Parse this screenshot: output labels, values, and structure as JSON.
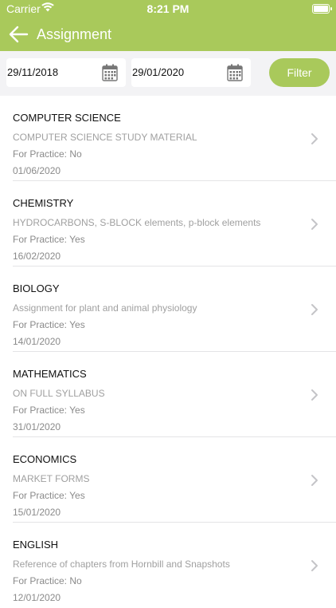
{
  "status": {
    "carrier": "Carrier",
    "time": "8:21 PM"
  },
  "nav": {
    "title": "Assignment"
  },
  "filter": {
    "from_date": "29/11/2018",
    "to_date": "29/01/2020",
    "button_label": "Filter"
  },
  "assignments": [
    {
      "subject": "COMPUTER SCIENCE",
      "description": "COMPUTER SCIENCE STUDY MATERIAL",
      "practice": "For Practice: No",
      "date": "01/06/2020"
    },
    {
      "subject": "CHEMISTRY",
      "description": "HYDROCARBONS, S-BLOCK elements, p-block elements",
      "practice": "For Practice: Yes",
      "date": "16/02/2020"
    },
    {
      "subject": "BIOLOGY",
      "description": "Assignment for plant and animal physiology",
      "practice": "For Practice: Yes",
      "date": "14/01/2020"
    },
    {
      "subject": "MATHEMATICS",
      "description": "ON FULL SYLLABUS",
      "practice": "For Practice: Yes",
      "date": "31/01/2020"
    },
    {
      "subject": "ECONOMICS",
      "description": "MARKET FORMS",
      "practice": "For Practice: Yes",
      "date": "15/01/2020"
    },
    {
      "subject": "ENGLISH",
      "description": "Reference of chapters from Hornbill and Snapshots",
      "practice": "For Practice: No",
      "date": "12/01/2020"
    }
  ],
  "icons": {
    "back": "arrow-left-icon",
    "calendar": "calendar-icon",
    "chevron": "chevron-right-icon",
    "wifi": "wifi-icon",
    "battery": "battery-icon"
  },
  "colors": {
    "brand": "#a9c95b",
    "background": "#f3f3f5",
    "muted_text": "#8a8a8a"
  }
}
